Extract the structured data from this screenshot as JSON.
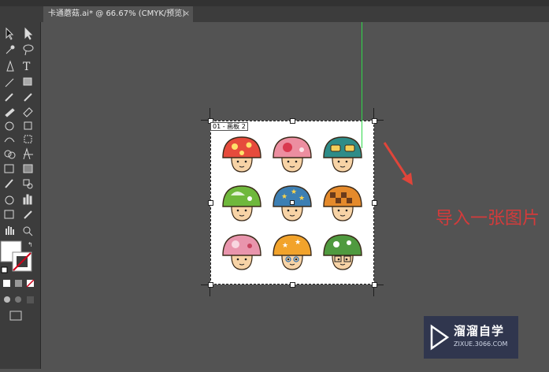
{
  "document_tab": {
    "title": "卡通蘑菇.ai* @ 66.67% (CMYK/预览)",
    "close_glyph": "×"
  },
  "artboard": {
    "label": "01 - 画板 2"
  },
  "annotation": {
    "text": "导入一张图片",
    "color": "#d33b3b"
  },
  "watermark": {
    "brand": "溜溜自学",
    "url": "ZIXUE.3066.COM"
  },
  "tools": [
    "selection-tool",
    "direct-selection-tool",
    "magic-wand-tool",
    "lasso-tool",
    "pen-tool",
    "type-tool",
    "line-tool",
    "rectangle-tool",
    "paintbrush-tool",
    "pencil-tool",
    "blob-brush-tool",
    "eraser-tool",
    "rotate-tool",
    "scale-tool",
    "warp-tool",
    "free-transform-tool",
    "shape-builder-tool",
    "perspective-grid-tool",
    "mesh-tool",
    "gradient-tool",
    "eyedropper-tool",
    "blend-tool",
    "symbol-sprayer-tool",
    "column-graph-tool",
    "artboard-tool",
    "slice-tool",
    "hand-tool",
    "zoom-tool"
  ],
  "colors": {
    "accent_guide": "#2fd84a",
    "fill_swatch": "#ffffff",
    "stroke_none": "#d0021b"
  }
}
